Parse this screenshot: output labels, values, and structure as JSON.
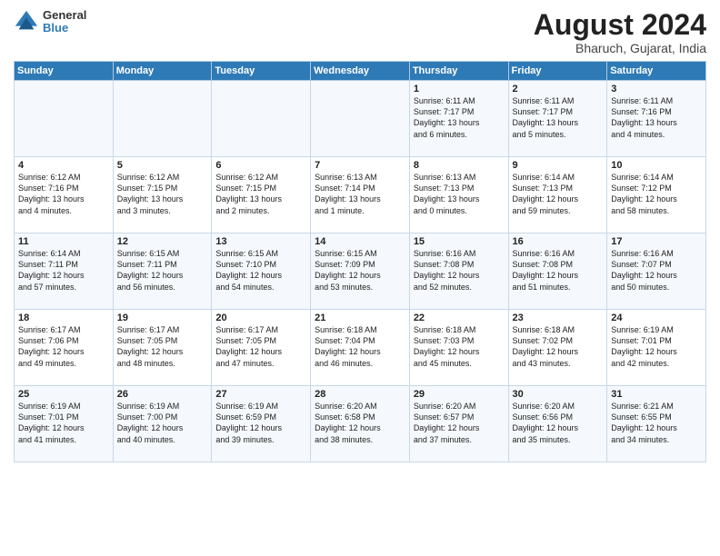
{
  "header": {
    "logo_line1": "General",
    "logo_line2": "Blue",
    "month_title": "August 2024",
    "subtitle": "Bharuch, Gujarat, India"
  },
  "weekdays": [
    "Sunday",
    "Monday",
    "Tuesday",
    "Wednesday",
    "Thursday",
    "Friday",
    "Saturday"
  ],
  "weeks": [
    [
      {
        "day": "",
        "text": ""
      },
      {
        "day": "",
        "text": ""
      },
      {
        "day": "",
        "text": ""
      },
      {
        "day": "",
        "text": ""
      },
      {
        "day": "1",
        "text": "Sunrise: 6:11 AM\nSunset: 7:17 PM\nDaylight: 13 hours\nand 6 minutes."
      },
      {
        "day": "2",
        "text": "Sunrise: 6:11 AM\nSunset: 7:17 PM\nDaylight: 13 hours\nand 5 minutes."
      },
      {
        "day": "3",
        "text": "Sunrise: 6:11 AM\nSunset: 7:16 PM\nDaylight: 13 hours\nand 4 minutes."
      }
    ],
    [
      {
        "day": "4",
        "text": "Sunrise: 6:12 AM\nSunset: 7:16 PM\nDaylight: 13 hours\nand 4 minutes."
      },
      {
        "day": "5",
        "text": "Sunrise: 6:12 AM\nSunset: 7:15 PM\nDaylight: 13 hours\nand 3 minutes."
      },
      {
        "day": "6",
        "text": "Sunrise: 6:12 AM\nSunset: 7:15 PM\nDaylight: 13 hours\nand 2 minutes."
      },
      {
        "day": "7",
        "text": "Sunrise: 6:13 AM\nSunset: 7:14 PM\nDaylight: 13 hours\nand 1 minute."
      },
      {
        "day": "8",
        "text": "Sunrise: 6:13 AM\nSunset: 7:13 PM\nDaylight: 13 hours\nand 0 minutes."
      },
      {
        "day": "9",
        "text": "Sunrise: 6:14 AM\nSunset: 7:13 PM\nDaylight: 12 hours\nand 59 minutes."
      },
      {
        "day": "10",
        "text": "Sunrise: 6:14 AM\nSunset: 7:12 PM\nDaylight: 12 hours\nand 58 minutes."
      }
    ],
    [
      {
        "day": "11",
        "text": "Sunrise: 6:14 AM\nSunset: 7:11 PM\nDaylight: 12 hours\nand 57 minutes."
      },
      {
        "day": "12",
        "text": "Sunrise: 6:15 AM\nSunset: 7:11 PM\nDaylight: 12 hours\nand 56 minutes."
      },
      {
        "day": "13",
        "text": "Sunrise: 6:15 AM\nSunset: 7:10 PM\nDaylight: 12 hours\nand 54 minutes."
      },
      {
        "day": "14",
        "text": "Sunrise: 6:15 AM\nSunset: 7:09 PM\nDaylight: 12 hours\nand 53 minutes."
      },
      {
        "day": "15",
        "text": "Sunrise: 6:16 AM\nSunset: 7:08 PM\nDaylight: 12 hours\nand 52 minutes."
      },
      {
        "day": "16",
        "text": "Sunrise: 6:16 AM\nSunset: 7:08 PM\nDaylight: 12 hours\nand 51 minutes."
      },
      {
        "day": "17",
        "text": "Sunrise: 6:16 AM\nSunset: 7:07 PM\nDaylight: 12 hours\nand 50 minutes."
      }
    ],
    [
      {
        "day": "18",
        "text": "Sunrise: 6:17 AM\nSunset: 7:06 PM\nDaylight: 12 hours\nand 49 minutes."
      },
      {
        "day": "19",
        "text": "Sunrise: 6:17 AM\nSunset: 7:05 PM\nDaylight: 12 hours\nand 48 minutes."
      },
      {
        "day": "20",
        "text": "Sunrise: 6:17 AM\nSunset: 7:05 PM\nDaylight: 12 hours\nand 47 minutes."
      },
      {
        "day": "21",
        "text": "Sunrise: 6:18 AM\nSunset: 7:04 PM\nDaylight: 12 hours\nand 46 minutes."
      },
      {
        "day": "22",
        "text": "Sunrise: 6:18 AM\nSunset: 7:03 PM\nDaylight: 12 hours\nand 45 minutes."
      },
      {
        "day": "23",
        "text": "Sunrise: 6:18 AM\nSunset: 7:02 PM\nDaylight: 12 hours\nand 43 minutes."
      },
      {
        "day": "24",
        "text": "Sunrise: 6:19 AM\nSunset: 7:01 PM\nDaylight: 12 hours\nand 42 minutes."
      }
    ],
    [
      {
        "day": "25",
        "text": "Sunrise: 6:19 AM\nSunset: 7:01 PM\nDaylight: 12 hours\nand 41 minutes."
      },
      {
        "day": "26",
        "text": "Sunrise: 6:19 AM\nSunset: 7:00 PM\nDaylight: 12 hours\nand 40 minutes."
      },
      {
        "day": "27",
        "text": "Sunrise: 6:19 AM\nSunset: 6:59 PM\nDaylight: 12 hours\nand 39 minutes."
      },
      {
        "day": "28",
        "text": "Sunrise: 6:20 AM\nSunset: 6:58 PM\nDaylight: 12 hours\nand 38 minutes."
      },
      {
        "day": "29",
        "text": "Sunrise: 6:20 AM\nSunset: 6:57 PM\nDaylight: 12 hours\nand 37 minutes."
      },
      {
        "day": "30",
        "text": "Sunrise: 6:20 AM\nSunset: 6:56 PM\nDaylight: 12 hours\nand 35 minutes."
      },
      {
        "day": "31",
        "text": "Sunrise: 6:21 AM\nSunset: 6:55 PM\nDaylight: 12 hours\nand 34 minutes."
      }
    ]
  ]
}
